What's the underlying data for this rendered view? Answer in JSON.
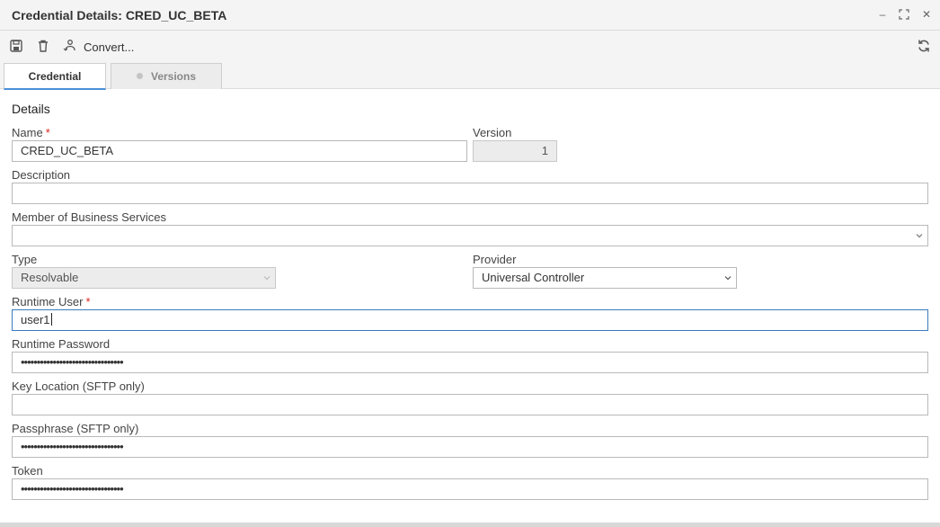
{
  "window": {
    "title": "Credential Details: CRED_UC_BETA",
    "minimize_glyph": "–",
    "maximize_glyph": "⛶",
    "close_glyph": "✕"
  },
  "toolbar": {
    "save_icon": "save-icon",
    "delete_icon": "trash-icon",
    "convert_icon": "convert-icon",
    "convert_label": "Convert...",
    "refresh_icon": "refresh-icon"
  },
  "tabs": [
    {
      "label": "Credential",
      "active": true
    },
    {
      "label": "Versions",
      "active": false
    }
  ],
  "form": {
    "section_title": "Details",
    "name": {
      "label": "Name",
      "required": "*",
      "value": "CRED_UC_BETA"
    },
    "version": {
      "label": "Version",
      "value": "1"
    },
    "description": {
      "label": "Description",
      "value": ""
    },
    "business_services": {
      "label": "Member of Business Services",
      "value": ""
    },
    "type": {
      "label": "Type",
      "value": "Resolvable"
    },
    "provider": {
      "label": "Provider",
      "value": "Universal Controller"
    },
    "runtime_user": {
      "label": "Runtime User",
      "required": "*",
      "value": "user1"
    },
    "runtime_password": {
      "label": "Runtime Password",
      "value": "••••••••••••••••••••••••••••••••"
    },
    "key_location": {
      "label": "Key Location (SFTP only)",
      "value": ""
    },
    "passphrase": {
      "label": "Passphrase (SFTP only)",
      "value": "••••••••••••••••••••••••••••••••"
    },
    "token": {
      "label": "Token",
      "value": "••••••••••••••••••••••••••••••••"
    }
  },
  "colors": {
    "accent": "#4a90d9",
    "required": "#d9261c",
    "focus_border": "#3a7bbf"
  }
}
